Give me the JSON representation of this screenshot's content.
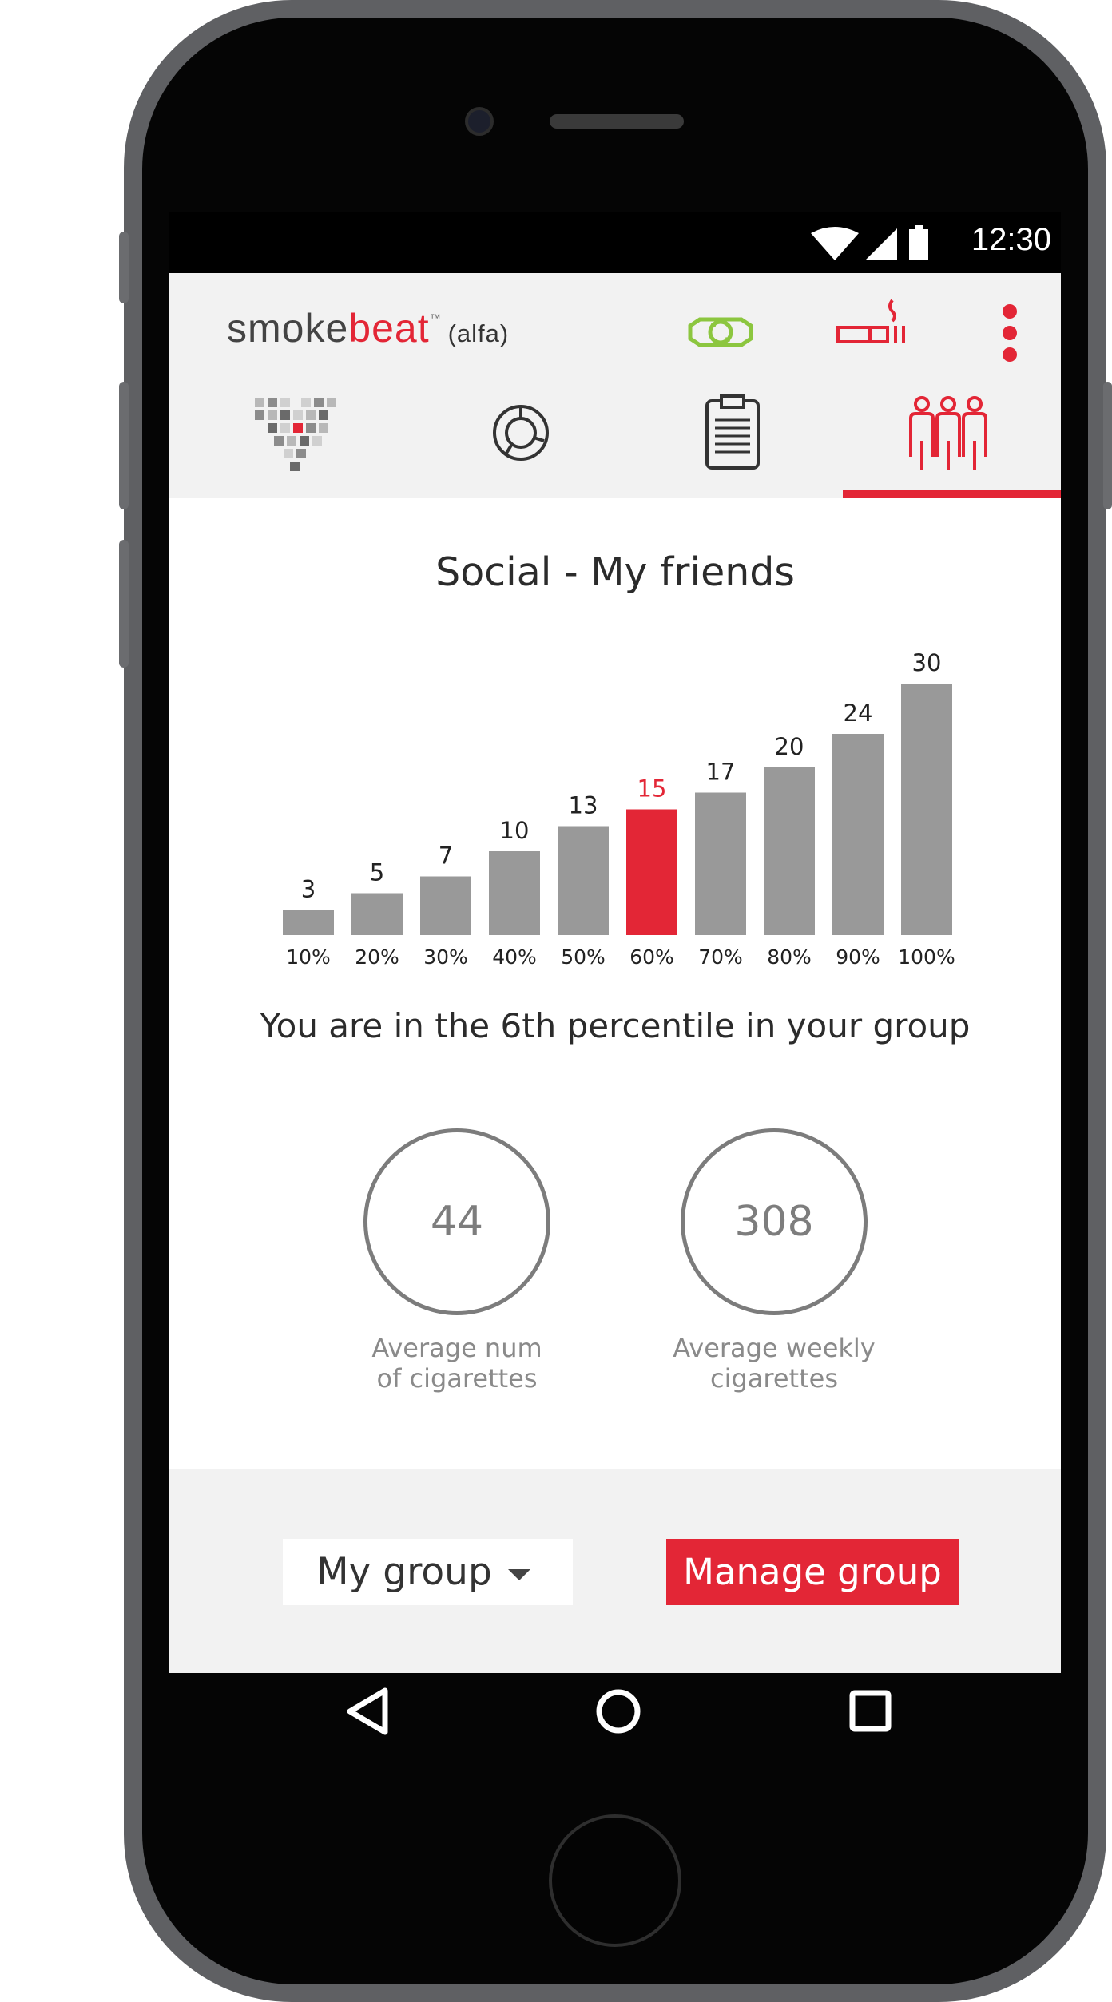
{
  "status_bar": {
    "time": "12:30"
  },
  "app_bar": {
    "logo_smoke": "smoke",
    "logo_beat": "beat",
    "logo_tm": "™",
    "logo_suffix": "(alfa)"
  },
  "tabs": [
    {
      "id": "heart",
      "icon": "pixel-heart-icon",
      "active": false
    },
    {
      "id": "stats",
      "icon": "donut-chart-icon",
      "active": false
    },
    {
      "id": "log",
      "icon": "clipboard-icon",
      "active": false
    },
    {
      "id": "social",
      "icon": "people-group-icon",
      "active": true
    }
  ],
  "page": {
    "title": "Social - My friends",
    "percentile_text": "You are in the 6th percentile in your group"
  },
  "chart_data": {
    "type": "bar",
    "categories": [
      "10%",
      "20%",
      "30%",
      "40%",
      "50%",
      "60%",
      "70%",
      "80%",
      "90%",
      "100%"
    ],
    "values": [
      3,
      5,
      7,
      10,
      13,
      15,
      17,
      20,
      24,
      30
    ],
    "highlight_index": 5,
    "ylim": [
      0,
      30
    ],
    "title": "",
    "xlabel": "",
    "ylabel": "",
    "grid": false,
    "colors": {
      "bar": "#999999",
      "highlight": "#e32636",
      "label": "#222222"
    }
  },
  "stats": {
    "avg_num": {
      "value": "44",
      "label_line1": "Average num",
      "label_line2": "of cigarettes"
    },
    "avg_weekly": {
      "value": "308",
      "label_line1": "Average weekly",
      "label_line2": "cigarettes"
    }
  },
  "bottom": {
    "group_select_value": "My group",
    "manage_label": "Manage group"
  },
  "colors": {
    "accent": "#e32636",
    "green": "#8cc63f",
    "bar_grey": "#999999",
    "app_bar_bg": "#f2f2f2"
  }
}
